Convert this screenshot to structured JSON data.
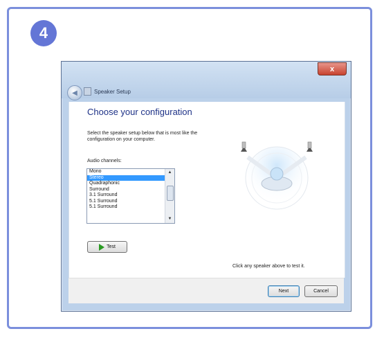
{
  "step": {
    "number": "4"
  },
  "window": {
    "title": "Speaker Setup",
    "close_glyph": "x",
    "back_glyph": "◀"
  },
  "content": {
    "heading": "Choose your configuration",
    "description": "Select the speaker setup below that is most like the configuration on your computer.",
    "audio_channels_label": "Audio channels:",
    "channels": [
      {
        "label": "Mono",
        "selected": false
      },
      {
        "label": "Stereo",
        "selected": true
      },
      {
        "label": "Quadraphonic",
        "selected": false
      },
      {
        "label": "Surround",
        "selected": false
      },
      {
        "label": "3.1 Surround",
        "selected": false
      },
      {
        "label": "5.1 Surround",
        "selected": false
      },
      {
        "label": "5.1 Surround",
        "selected": false
      }
    ],
    "scroll_up_glyph": "▲",
    "scroll_down_glyph": "▼",
    "test_button_label": "Test",
    "hint": "Click any speaker above to test it."
  },
  "footer": {
    "next_label": "Next",
    "cancel_label": "Cancel"
  },
  "colors": {
    "accent_border": "#7b8fdc",
    "badge": "#6476d6",
    "heading": "#1e3287",
    "selection": "#3399ff"
  },
  "icons": {
    "back": "back-arrow-icon",
    "title": "speaker-icon",
    "test": "play-icon"
  }
}
